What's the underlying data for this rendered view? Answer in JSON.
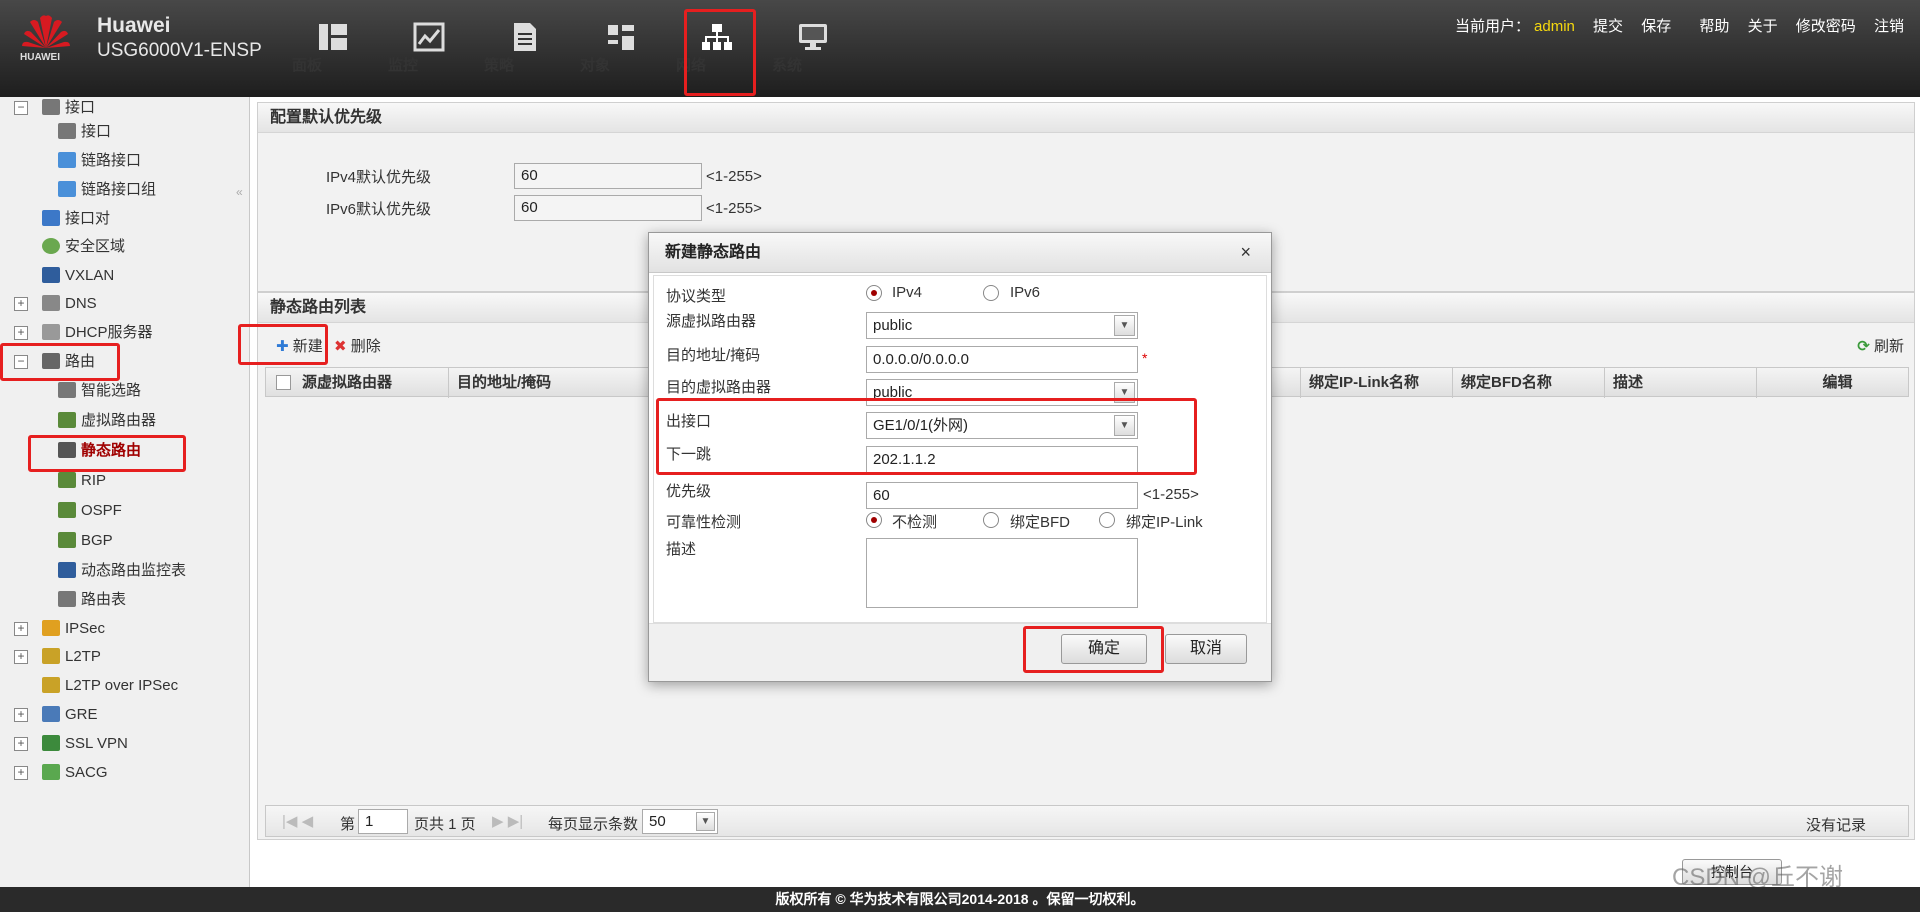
{
  "header": {
    "brand_line1": "Huawei",
    "brand_line2": "USG6000V1-ENSP",
    "logo_text": "HUAWEI",
    "nav": [
      {
        "label": "面板",
        "icon": "dashboard-icon"
      },
      {
        "label": "监控",
        "icon": "monitor-icon"
      },
      {
        "label": "策略",
        "icon": "policy-icon"
      },
      {
        "label": "对象",
        "icon": "object-icon"
      },
      {
        "label": "网络",
        "icon": "network-icon"
      },
      {
        "label": "系统",
        "icon": "system-icon"
      }
    ],
    "current_user_label": "当前用户：",
    "current_user": "admin",
    "actions": [
      "提交",
      "保存",
      "帮助",
      "关于",
      "修改密码",
      "注销"
    ]
  },
  "sidebar": {
    "items": [
      "接口",
      "接口",
      "链路接口",
      "链路接口组",
      "接口对",
      "安全区域",
      "VXLAN",
      "DNS",
      "DHCP服务器",
      "路由",
      "智能选路",
      "虚拟路由器",
      "静态路由",
      "RIP",
      "OSPF",
      "BGP",
      "动态路由监控表",
      "路由表",
      "IPSec",
      "L2TP",
      "L2TP over IPSec",
      "GRE",
      "SSL VPN",
      "SACG"
    ]
  },
  "priority_panel": {
    "title": "配置默认优先级",
    "ipv4_label": "IPv4默认优先级",
    "ipv4_value": "60",
    "ipv4_range": "<1-255>",
    "ipv6_label": "IPv6默认优先级",
    "ipv6_value": "60",
    "ipv6_range": "<1-255>"
  },
  "route_list": {
    "title": "静态路由列表",
    "new_label": "新建",
    "delete_label": "删除",
    "refresh_label": "刷新",
    "columns": [
      "源虚拟路由器",
      "目的地址/掩码",
      "绑定IP-Link名称",
      "绑定BFD名称",
      "描述",
      "编辑"
    ],
    "empty": "没有记录"
  },
  "pager": {
    "page_label": "第",
    "page": "1",
    "of_label": "页共 1 页",
    "per_page_label": "每页显示条数",
    "per_page": "50"
  },
  "console": "控制台",
  "watermark": "CSDN @丘不谢",
  "dialog": {
    "title": "新建静态路由",
    "close": "×",
    "protocol_label": "协议类型",
    "ipv4": "IPv4",
    "ipv6": "IPv6",
    "src_vr_label": "源虚拟路由器",
    "src_vr": "public",
    "dest_label": "目的地址/掩码",
    "dest": "0.0.0.0/0.0.0.0",
    "required": "*",
    "dest_vr_label": "目的虚拟路由器",
    "dest_vr": "public",
    "out_if_label": "出接口",
    "out_if": "GE1/0/1(外网)",
    "next_hop_label": "下一跳",
    "next_hop": "202.1.1.2",
    "priority_label": "优先级",
    "priority": "60",
    "priority_range": "<1-255>",
    "reliability_label": "可靠性检测",
    "no_detect": "不检测",
    "bind_bfd": "绑定BFD",
    "bind_iplink": "绑定IP-Link",
    "desc_label": "描述",
    "ok": "确定",
    "cancel": "取消"
  },
  "footer": "版权所有 © 华为技术有限公司2014-2018 。保留一切权利。",
  "colors": {
    "accent_red": "#e61f1f",
    "admin_yellow": "#f6d90e",
    "active_text": "#a00000"
  }
}
